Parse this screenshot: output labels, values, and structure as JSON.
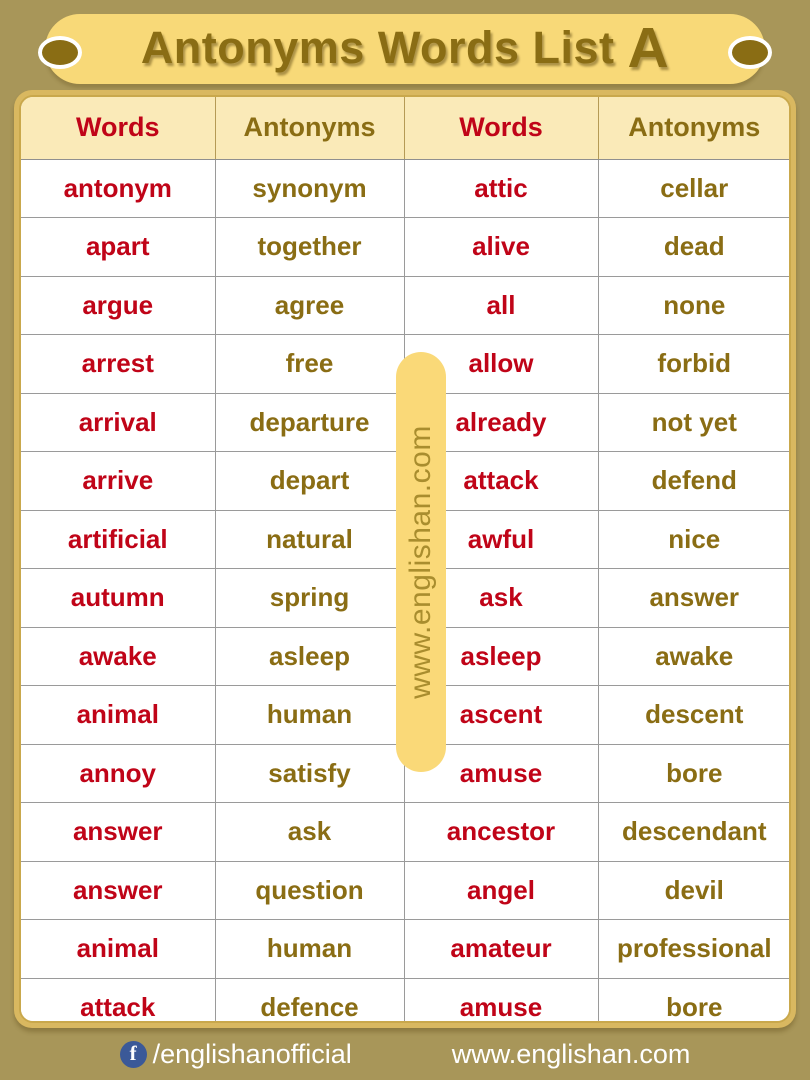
{
  "banner": {
    "title_main": "Antonyms Words  List ",
    "title_letter": "A",
    "dot_left": "decorative-dot",
    "dot_right": "decorative-dot"
  },
  "watermark": {
    "text": "www.englishan.com"
  },
  "table": {
    "headers": [
      "Words",
      "Antonyms",
      "Words",
      "Antonyms"
    ],
    "rows": [
      [
        "antonym",
        "synonym",
        "attic",
        "cellar"
      ],
      [
        "apart",
        "together",
        "alive",
        "dead"
      ],
      [
        "argue",
        "agree",
        "all",
        "none"
      ],
      [
        "arrest",
        "free",
        "allow",
        "forbid"
      ],
      [
        "arrival",
        "departure",
        "already",
        "not yet"
      ],
      [
        "arrive",
        "depart",
        "attack",
        "defend"
      ],
      [
        "artificial",
        "natural",
        "awful",
        "nice"
      ],
      [
        "autumn",
        "spring",
        "ask",
        "answer"
      ],
      [
        "awake",
        "asleep",
        "asleep",
        "awake"
      ],
      [
        "animal",
        "human",
        "ascent",
        "descent"
      ],
      [
        "annoy",
        "satisfy",
        "amuse",
        "bore"
      ],
      [
        "answer",
        "ask",
        "ancestor",
        "descendant"
      ],
      [
        "answer",
        "question",
        "angel",
        "devil"
      ],
      [
        "animal",
        "human",
        "amateur",
        "professional"
      ],
      [
        "attack",
        "defence",
        "amuse",
        "bore"
      ]
    ]
  },
  "footer": {
    "facebook_glyph": "f",
    "facebook_handle": "/englishanofficial",
    "website": "www.englishan.com"
  },
  "colors": {
    "background": "#a89659",
    "banner": "#f8d978",
    "word_text": "#c00418",
    "antonym_text": "#8a6d14",
    "header_bg": "#faeab8",
    "frame": "#d9b860",
    "facebook_blue": "#3b5998"
  }
}
